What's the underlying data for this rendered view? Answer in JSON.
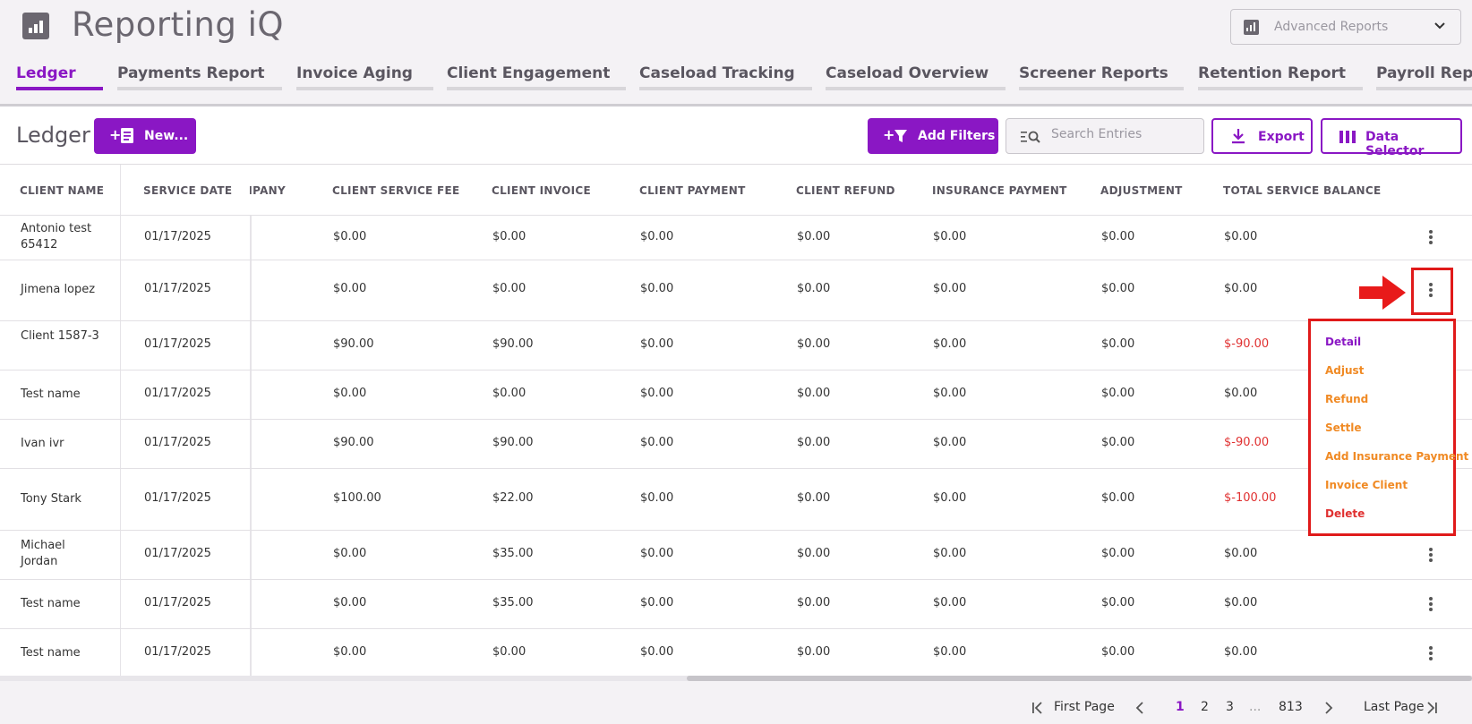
{
  "app": {
    "title": "Reporting iQ"
  },
  "report_select": {
    "value": "Advanced Reports",
    "icon": "bar-chart-icon"
  },
  "tabs": [
    {
      "label": "Ledger",
      "active": true
    },
    {
      "label": "Payments Report"
    },
    {
      "label": "Invoice Aging"
    },
    {
      "label": "Client Engagement"
    },
    {
      "label": "Caseload Tracking"
    },
    {
      "label": "Caseload Overview"
    },
    {
      "label": "Screener Reports"
    },
    {
      "label": "Retention Report"
    },
    {
      "label": "Payroll Repo"
    }
  ],
  "toolbar": {
    "page_title": "Ledger",
    "new_label": "New...",
    "add_filters_label": "Add Filters",
    "search_placeholder": "Search Entries",
    "export_label": "Export",
    "data_selector_label": "Data Selector"
  },
  "table": {
    "columns": [
      "CLIENT NAME",
      "SERVICE DATE",
      "MPANY",
      "CLIENT SERVICE FEE",
      "CLIENT INVOICE",
      "CLIENT PAYMENT",
      "CLIENT REFUND",
      "INSURANCE PAYMENT",
      "ADJUSTMENT",
      "TOTAL SERVICE BALANCE"
    ],
    "rows": [
      {
        "name": "Antonio test 65412",
        "date": "01/17/2025",
        "fee": "$0.00",
        "invoice": "$0.00",
        "payment": "$0.00",
        "refund": "$0.00",
        "insurance": "$0.00",
        "adjustment": "$0.00",
        "balance": "$0.00"
      },
      {
        "name": "Jimena lopez",
        "date": "01/17/2025",
        "fee": "$0.00",
        "invoice": "$0.00",
        "payment": "$0.00",
        "refund": "$0.00",
        "insurance": "$0.00",
        "adjustment": "$0.00",
        "balance": "$0.00"
      },
      {
        "name": "Client 1587-3",
        "date": "01/17/2025",
        "fee": "$90.00",
        "invoice": "$90.00",
        "payment": "$0.00",
        "refund": "$0.00",
        "insurance": "$0.00",
        "adjustment": "$0.00",
        "balance": "$-90.00"
      },
      {
        "name": "Test name",
        "date": "01/17/2025",
        "fee": "$0.00",
        "invoice": "$0.00",
        "payment": "$0.00",
        "refund": "$0.00",
        "insurance": "$0.00",
        "adjustment": "$0.00",
        "balance": "$0.00"
      },
      {
        "name": "Ivan ivr",
        "date": "01/17/2025",
        "fee": "$90.00",
        "invoice": "$90.00",
        "payment": "$0.00",
        "refund": "$0.00",
        "insurance": "$0.00",
        "adjustment": "$0.00",
        "balance": "$-90.00"
      },
      {
        "name": "Tony Stark",
        "date": "01/17/2025",
        "fee": "$100.00",
        "invoice": "$22.00",
        "payment": "$0.00",
        "refund": "$0.00",
        "insurance": "$0.00",
        "adjustment": "$0.00",
        "balance": "$-100.00"
      },
      {
        "name": "Michael Jordan",
        "date": "01/17/2025",
        "fee": "$0.00",
        "invoice": "$35.00",
        "payment": "$0.00",
        "refund": "$0.00",
        "insurance": "$0.00",
        "adjustment": "$0.00",
        "balance": "$0.00"
      },
      {
        "name": "Test name",
        "date": "01/17/2025",
        "fee": "$0.00",
        "invoice": "$35.00",
        "payment": "$0.00",
        "refund": "$0.00",
        "insurance": "$0.00",
        "adjustment": "$0.00",
        "balance": "$0.00"
      },
      {
        "name": "Test name",
        "date": "01/17/2025",
        "fee": "$0.00",
        "invoice": "$0.00",
        "payment": "$0.00",
        "refund": "$0.00",
        "insurance": "$0.00",
        "adjustment": "$0.00",
        "balance": "$0.00"
      }
    ]
  },
  "row_menu": {
    "items": [
      {
        "label": "Detail",
        "color": "#8a17c4"
      },
      {
        "label": "Adjust",
        "color": "#f08a24"
      },
      {
        "label": "Refund",
        "color": "#f08a24"
      },
      {
        "label": "Settle",
        "color": "#f08a24"
      },
      {
        "label": "Add Insurance Payment",
        "color": "#f08a24"
      },
      {
        "label": "Invoice Client",
        "color": "#f08a24"
      },
      {
        "label": "Delete",
        "color": "#e03030"
      }
    ]
  },
  "pagination": {
    "first_label": "First Page",
    "pages": [
      "1",
      "2",
      "3"
    ],
    "ellipsis": "...",
    "last_page_number": "813",
    "last_label": "Last Page",
    "current": "1"
  },
  "colors": {
    "accent": "#8a17c4",
    "negative": "#e03030",
    "warning": "#f08a24",
    "highlight": "#e01a1a"
  }
}
